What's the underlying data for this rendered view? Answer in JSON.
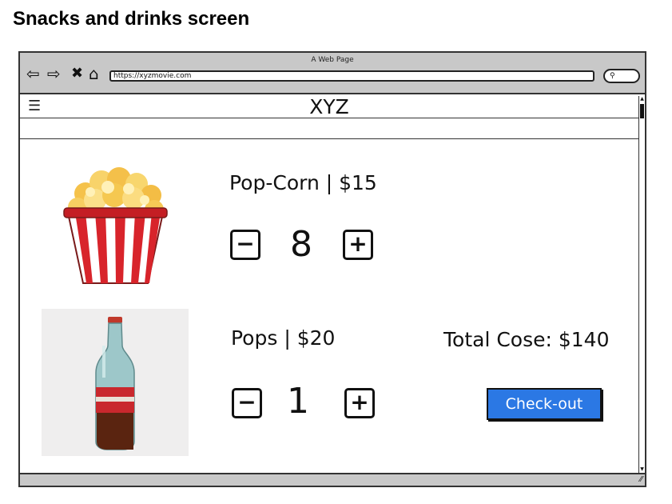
{
  "page_heading": "Snacks and drinks screen",
  "browser": {
    "window_title": "A Web Page",
    "url": "https://xyzmovie.com"
  },
  "app": {
    "brand": "XYZ"
  },
  "items": [
    {
      "title": "Pop-Corn | $15",
      "quantity": "8",
      "minus_label": "−",
      "plus_label": "+",
      "image": "popcorn-bucket-image"
    },
    {
      "title": "Pops | $20",
      "quantity": "1",
      "minus_label": "−",
      "plus_label": "+",
      "image": "soda-bottle-image"
    }
  ],
  "total_label": "Total Cose: $140",
  "checkout_label": "Check-out",
  "colors": {
    "chrome_gray": "#c8c8c8",
    "checkout_blue": "#2b78e4",
    "popcorn_red": "#d8242b"
  },
  "icons": [
    "back-icon",
    "forward-icon",
    "close-icon",
    "home-icon",
    "search-icon",
    "hamburger-menu-icon",
    "resize-grip-icon"
  ]
}
